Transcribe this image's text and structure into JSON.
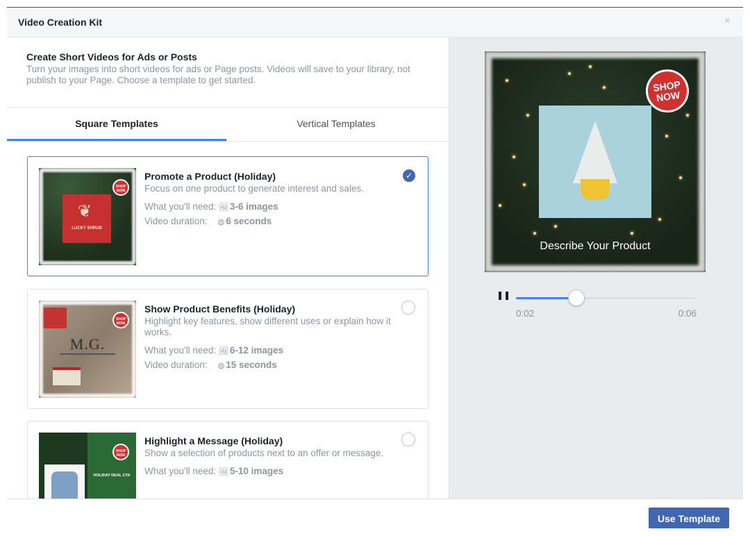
{
  "dialog": {
    "title": "Video Creation Kit",
    "close_glyph": "×"
  },
  "intro": {
    "heading": "Create Short Videos for Ads or Posts",
    "description": "Turn your images into short videos for ads or Page posts. Videos will save to your library, not publish to your Page. Choose a template to get started."
  },
  "tabs": [
    {
      "label": "Square Templates",
      "active": true
    },
    {
      "label": "Vertical Templates",
      "active": false
    }
  ],
  "templates": [
    {
      "name": "Promote a Product (Holiday)",
      "description": "Focus on one product to generate interest and sales.",
      "need_label": "What you'll need:",
      "need_value": "3-6 images",
      "duration_label": "Video duration:",
      "duration_value": "6 seconds",
      "selected": true,
      "thumb_text": "LUCKY SHRUB",
      "badge_text": "SHOP NOW"
    },
    {
      "name": "Show Product Benefits (Holiday)",
      "description": "Highlight key features, show different uses or explain how it works.",
      "need_label": "What you'll need:",
      "need_value": "6-12 images",
      "duration_label": "Video duration:",
      "duration_value": "15 seconds",
      "selected": false,
      "thumb_text": "M.G.",
      "badge_text": "SHOP NOW"
    },
    {
      "name": "Highlight a Message (Holiday)",
      "description": "Show a selection of products next to an offer or message.",
      "need_label": "What you'll need:",
      "need_value": "5-10 images",
      "selected": false,
      "thumb_text": "HOLIDAY DEAL CTA",
      "badge_text": "SHOP NOW"
    }
  ],
  "preview": {
    "badge_text": "SHOP NOW",
    "caption": "Describe Your Product"
  },
  "player": {
    "current_time": "0:02",
    "duration": "0:06",
    "progress": 0.333
  },
  "footer": {
    "primary_button": "Use Template"
  },
  "colors": {
    "accent": "#4080ff",
    "primary_button": "#4267b2",
    "badge_red": "#d32f2f"
  },
  "icons": {
    "images": "image-icon",
    "duration": "clock-icon",
    "selected": "checkmark-icon",
    "pause": "pause-icon",
    "close": "close-icon"
  }
}
